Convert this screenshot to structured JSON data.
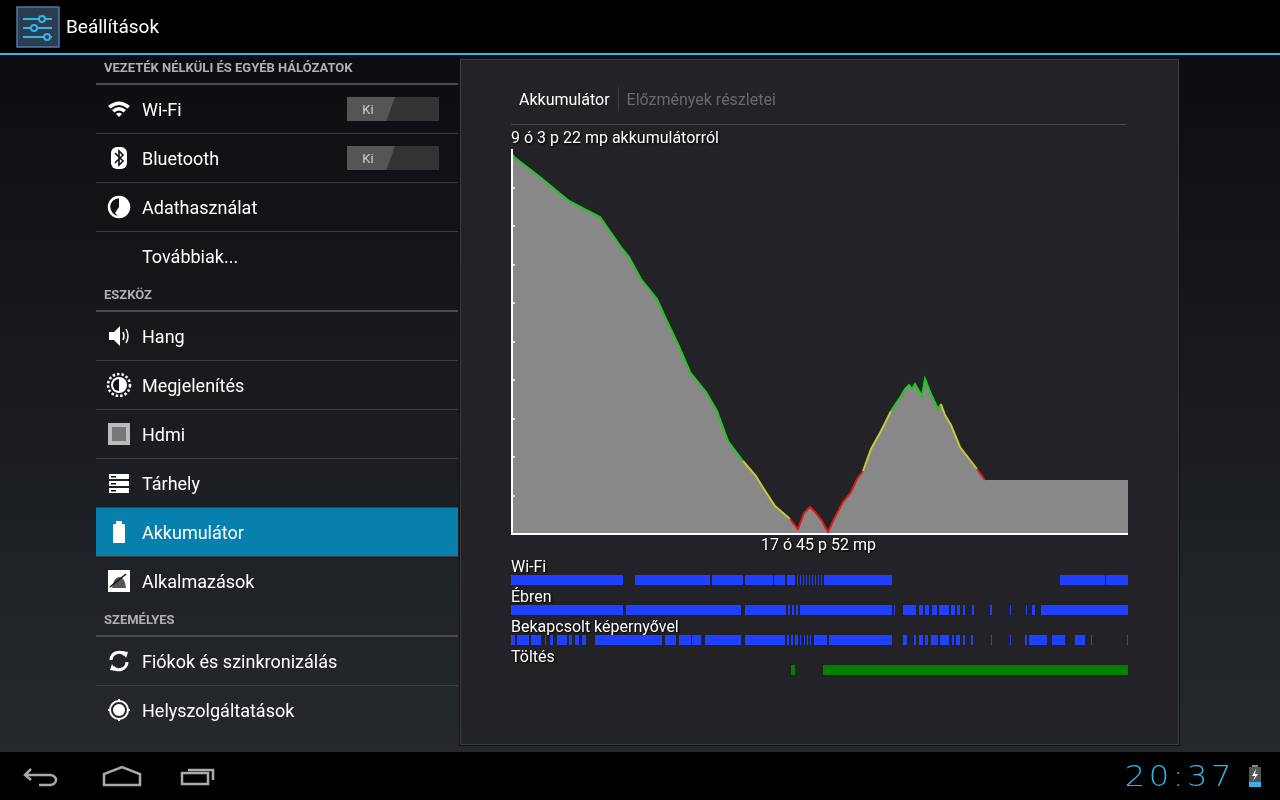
{
  "action_bar": {
    "title": "Beállítások"
  },
  "sections": [
    {
      "header": "VEZETÉK NÉLKÜLI ÉS EGYÉB HÁLÓZATOK",
      "items": [
        {
          "label": "Wi-Fi",
          "kind": "wifi",
          "selected": false,
          "toggle": {
            "label": "Ki",
            "on": false
          }
        },
        {
          "label": "Bluetooth",
          "kind": "bluetooth",
          "selected": false,
          "toggle": {
            "label": "Ki",
            "on": false
          }
        },
        {
          "label": "Adathasználat",
          "kind": "data",
          "selected": false
        },
        {
          "label": "Továbbiak...",
          "selected": false
        }
      ]
    },
    {
      "header": "ESZKÖZ",
      "items": [
        {
          "label": "Hang",
          "kind": "sound",
          "selected": false
        },
        {
          "label": "Megjelenítés",
          "kind": "display",
          "selected": false
        },
        {
          "label": "Hdmi",
          "kind": "hdmi",
          "selected": false
        },
        {
          "label": "Tárhely",
          "kind": "storage",
          "selected": false
        },
        {
          "label": "Akkumulátor",
          "kind": "battery",
          "selected": true
        },
        {
          "label": "Alkalmazások",
          "kind": "apps",
          "selected": false
        }
      ]
    },
    {
      "header": "SZEMÉLYES",
      "items": [
        {
          "label": "Fiókok és szinkronizálás",
          "kind": "sync",
          "selected": false
        },
        {
          "label": "Helyszolgáltatások",
          "kind": "location",
          "selected": false
        }
      ]
    }
  ],
  "detail": {
    "tabs": [
      {
        "label": "Akkumulátor",
        "selected": true
      },
      {
        "label": "Előzmények részletei",
        "selected": false
      }
    ],
    "summary": "9 ó 3 p 22 mp akkumulátorról",
    "duration": "17 ó 45 p 52 mp",
    "tracks": [
      {
        "label": "Wi-Fi",
        "color": "#2040ff"
      },
      {
        "label": "Ébren",
        "color": "#2040ff"
      },
      {
        "label": "Bekapcsolt képernyővel",
        "color": "#2040ff"
      },
      {
        "label": "Töltés",
        "color": "#008000"
      }
    ]
  },
  "status_bar": {
    "time": "20:37"
  }
}
